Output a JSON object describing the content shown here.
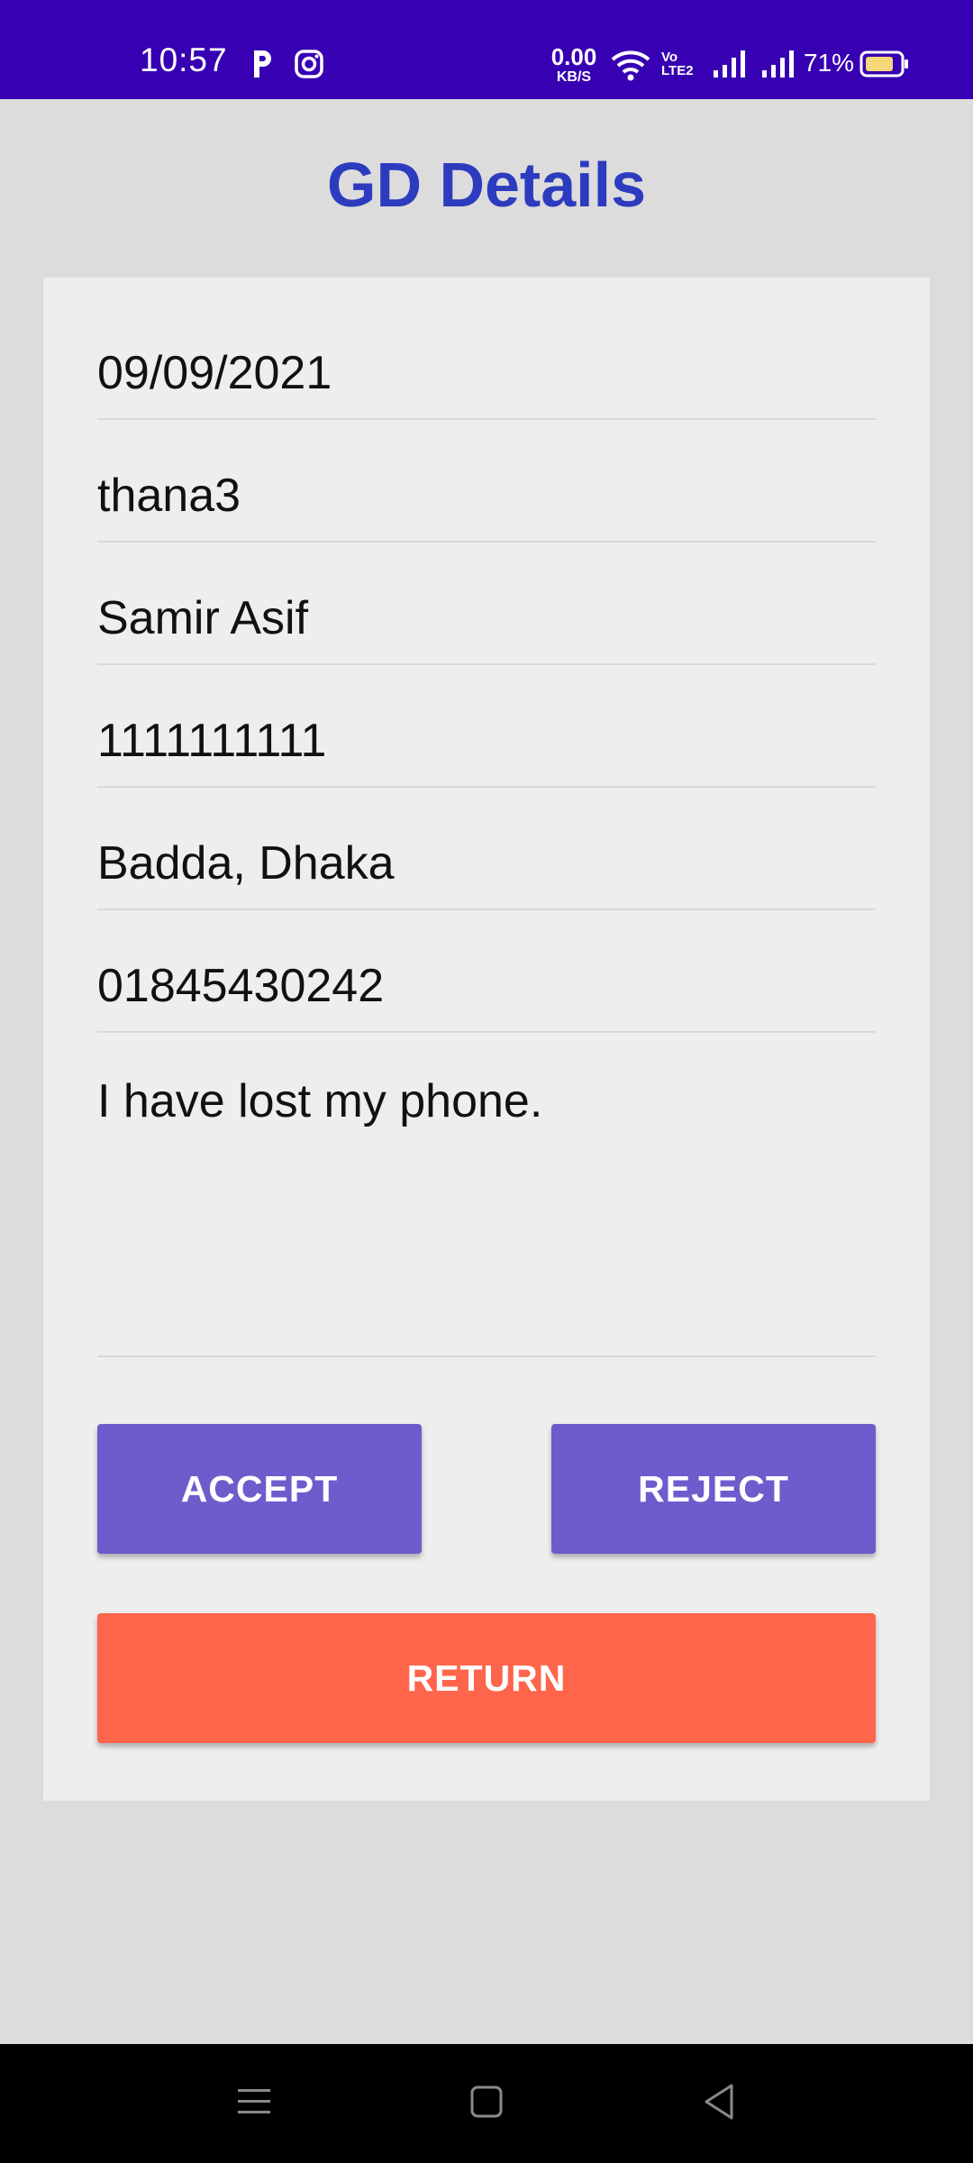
{
  "status_bar": {
    "time": "10:57",
    "net_speed_value": "0.00",
    "net_speed_unit": "KB/S",
    "volte_top": "Vo",
    "volte_bottom": "LTE2",
    "battery_percent": "71%",
    "icons": [
      "parking-icon",
      "instagram-icon",
      "wifi-icon",
      "volte-icon",
      "signal-icon",
      "signal-icon",
      "battery-icon"
    ],
    "background_color": "#3700b3"
  },
  "header": {
    "title": "GD Details",
    "title_color": "#2d3bbf"
  },
  "form": {
    "date": "09/09/2021",
    "thana": "thana3",
    "name": "Samir Asif",
    "nid": "1111111111",
    "address": "Badda, Dhaka",
    "phone": "01845430242",
    "description": "I have lost my phone."
  },
  "actions": {
    "accept_label": "ACCEPT",
    "reject_label": "REJECT",
    "return_label": "RETURN",
    "accept_color": "#6c5ccc",
    "reject_color": "#6c5ccc",
    "return_color": "#ff654b"
  },
  "nav_bar": {
    "icons": [
      "menu-icon",
      "home-icon",
      "back-icon"
    ]
  }
}
